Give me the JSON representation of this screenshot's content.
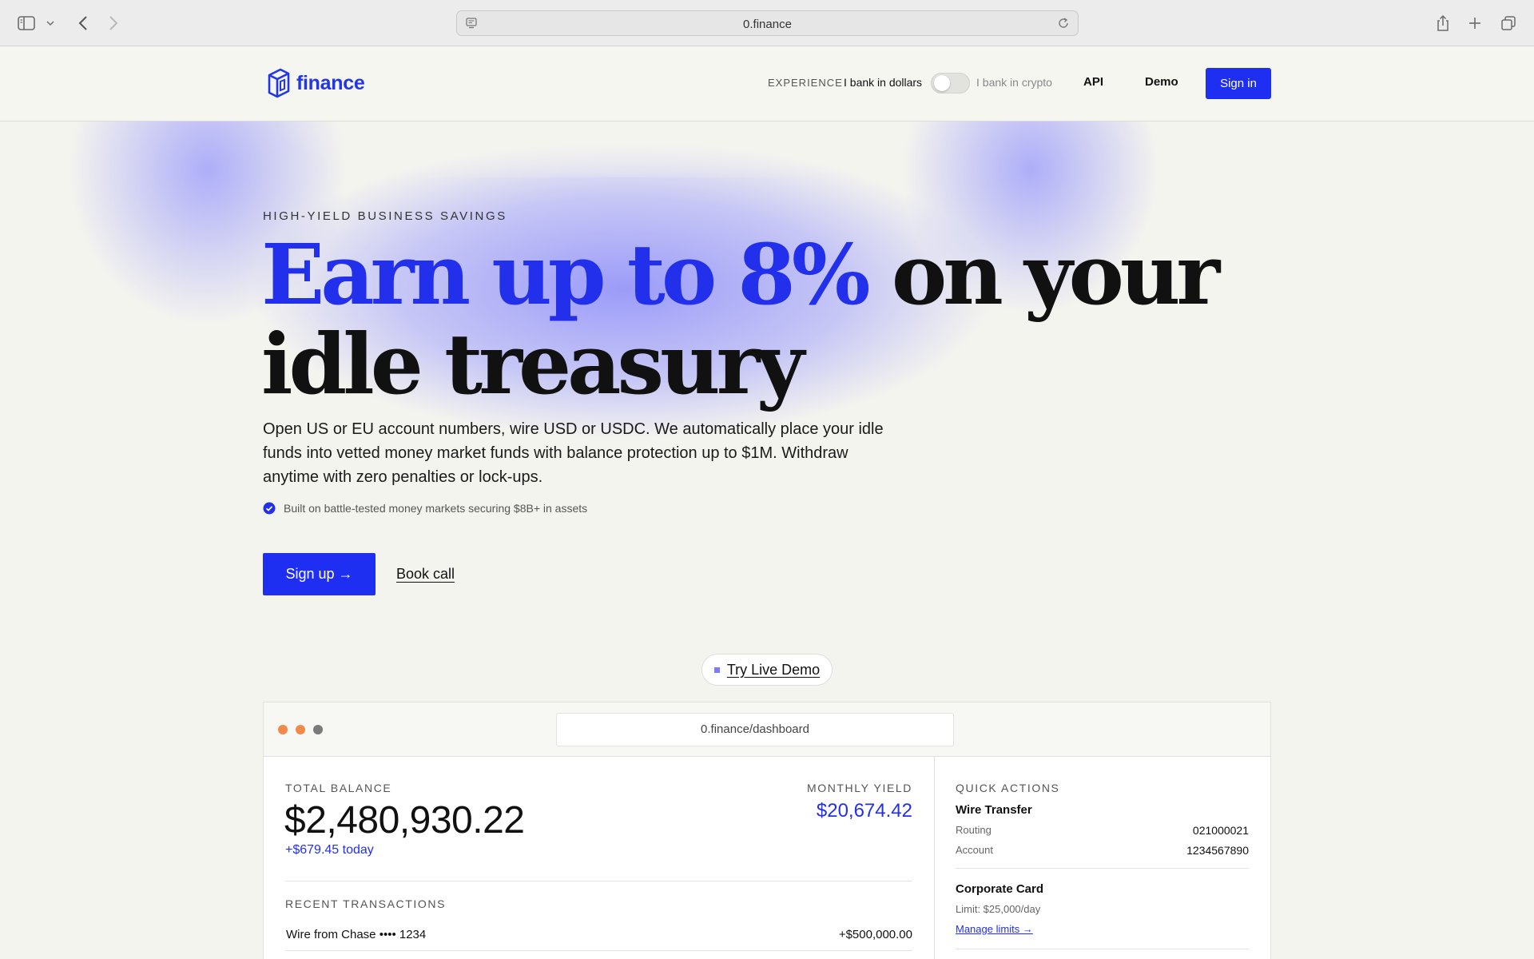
{
  "browser": {
    "url": "0.finance"
  },
  "header": {
    "brand": "finance",
    "experience_label": "EXPERIENCE",
    "toggle_left": "I bank in dollars",
    "toggle_right": "I bank in crypto",
    "toggle_on": false,
    "nav_api": "API",
    "nav_demo": "Demo",
    "signin": "Sign in"
  },
  "hero": {
    "eyebrow": "HIGH-YIELD BUSINESS SAVINGS",
    "headline_accent": "Earn up to 8%",
    "headline_rest": "on your idle treasury",
    "lede": "Open US or EU account numbers, wire USD or USDC. We automatically place your idle funds into vetted money market funds with balance protection up to $1M. Withdraw anytime with zero penalties or lock-ups.",
    "proof": "Built on battle-tested money markets securing $8B+ in assets",
    "signup": "Sign up →",
    "bookcall": "Book call"
  },
  "demo": {
    "pill": "Try Live Demo",
    "url": "0.finance/dashboard",
    "balance_label": "TOTAL BALANCE",
    "balance_value": "$2,480,930.22",
    "balance_today": "+$679.45 today",
    "yield_label": "MONTHLY YIELD",
    "yield_value": "$20,674.42",
    "recent_label": "RECENT TRANSACTIONS",
    "transactions": [
      {
        "name": "Wire from Chase •••• 1234",
        "amount": "+$500,000.00"
      }
    ],
    "quick_actions_label": "QUICK ACTIONS",
    "wire_title": "Wire Transfer",
    "routing_label": "Routing",
    "routing_value": "021000021",
    "account_label": "Account",
    "account_value": "1234567890",
    "card_title": "Corporate Card",
    "card_limit": "Limit: $25,000/day",
    "manage_limits": "Manage limits →"
  },
  "colors": {
    "accent": "#1f2ff2",
    "warning_dot": "#f2894a"
  }
}
